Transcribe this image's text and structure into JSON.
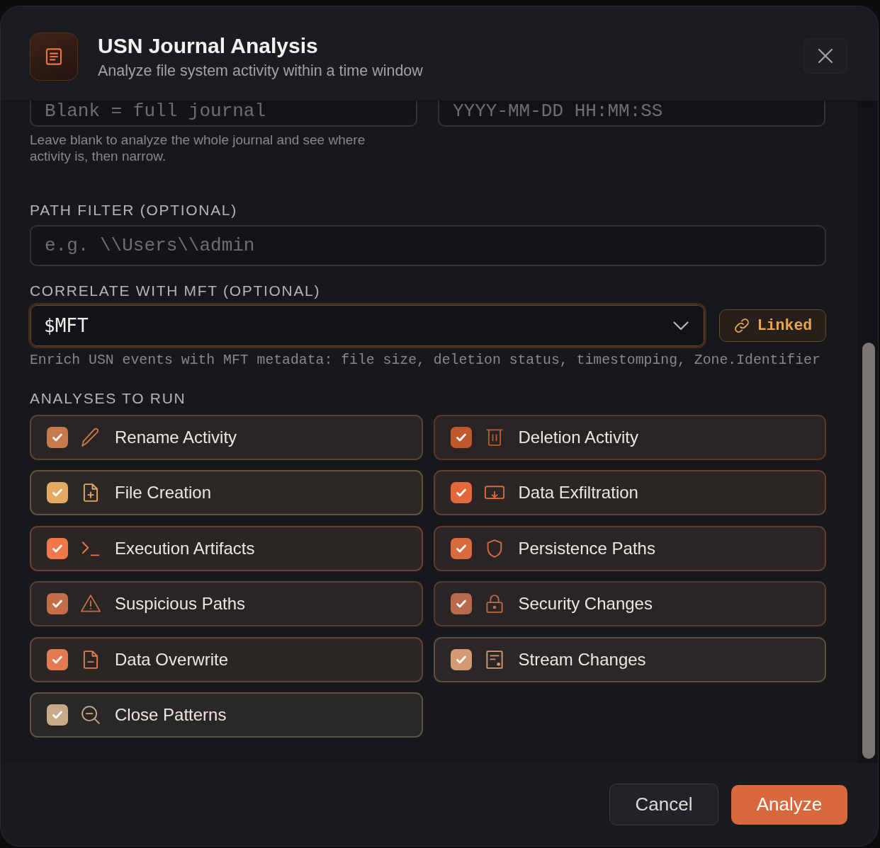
{
  "dialog": {
    "title": "USN Journal Analysis",
    "subtitle": "Analyze file system activity within a time window"
  },
  "time_fields": [
    {
      "placeholder": "Blank = full journal"
    },
    {
      "placeholder": "YYYY-MM-DD HH:MM:SS"
    }
  ],
  "time_hint": "Leave blank to analyze the whole journal and see where activity is, then narrow.",
  "path_filter": {
    "label": "PATH FILTER (OPTIONAL)",
    "placeholder": "e.g. \\\\Users\\\\admin"
  },
  "mft": {
    "label": "CORRELATE WITH MFT (OPTIONAL)",
    "value": "$MFT",
    "link_button": "Linked",
    "hint": "Enrich USN events with MFT metadata: file size, deletion status, timestomping, Zone.Identifier"
  },
  "analyses": {
    "label": "ANALYSES TO RUN",
    "items": [
      {
        "label": "Rename Activity",
        "checked": true,
        "color": "#c8794a"
      },
      {
        "label": "Deletion Activity",
        "checked": true,
        "color": "#c0582e"
      },
      {
        "label": "File Creation",
        "checked": true,
        "color": "#e3a862"
      },
      {
        "label": "Data Exfiltration",
        "checked": true,
        "color": "#e2673a"
      },
      {
        "label": "Execution Artifacts",
        "checked": true,
        "color": "#f07848"
      },
      {
        "label": "Persistence Paths",
        "checked": true,
        "color": "#d86a40"
      },
      {
        "label": "Suspicious Paths",
        "checked": true,
        "color": "#c46e48"
      },
      {
        "label": "Security Changes",
        "checked": true,
        "color": "#b86a4c"
      },
      {
        "label": "Data Overwrite",
        "checked": true,
        "color": "#e47a52"
      },
      {
        "label": "Stream Changes",
        "checked": true,
        "color": "#d49a74"
      },
      {
        "label": "Close Patterns",
        "checked": true,
        "color": "#c9aa88"
      }
    ]
  },
  "buttons": [
    {
      "label": "Cancel",
      "kind": "secondary"
    },
    {
      "label": "Analyze",
      "kind": "primary"
    }
  ]
}
